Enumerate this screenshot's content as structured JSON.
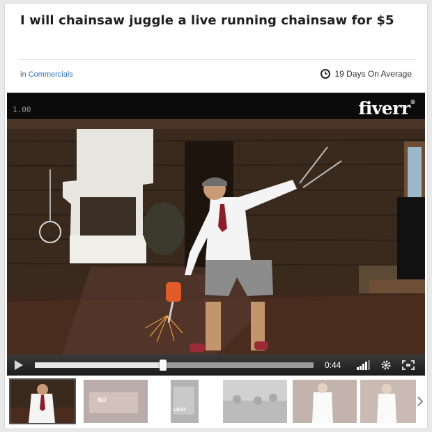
{
  "gig": {
    "title": "I will chainsaw juggle a live running chainsaw for $5",
    "category_prefix": "in",
    "category": "Commercials",
    "delivery": "19 Days On Average"
  },
  "video": {
    "overlay_timestamp": "1.00",
    "brand": "fiverr",
    "brand_mark": "®",
    "current_time": "0:44",
    "progress": 0.46
  },
  "thumbnails": {
    "items": [
      {
        "label": ""
      },
      {
        "label": "SU"
      },
      {
        "label": "LENT"
      },
      {
        "label": ""
      },
      {
        "label": ""
      },
      {
        "label": ""
      }
    ]
  },
  "colors": {
    "link": "#2a72b8",
    "video_bg": "#0b0b0b",
    "control_bar": "#2a2a2a"
  },
  "icons": [
    "clock-icon",
    "play-icon",
    "volume-icon",
    "settings-icon",
    "fullscreen-icon",
    "chevron-right-icon"
  ]
}
